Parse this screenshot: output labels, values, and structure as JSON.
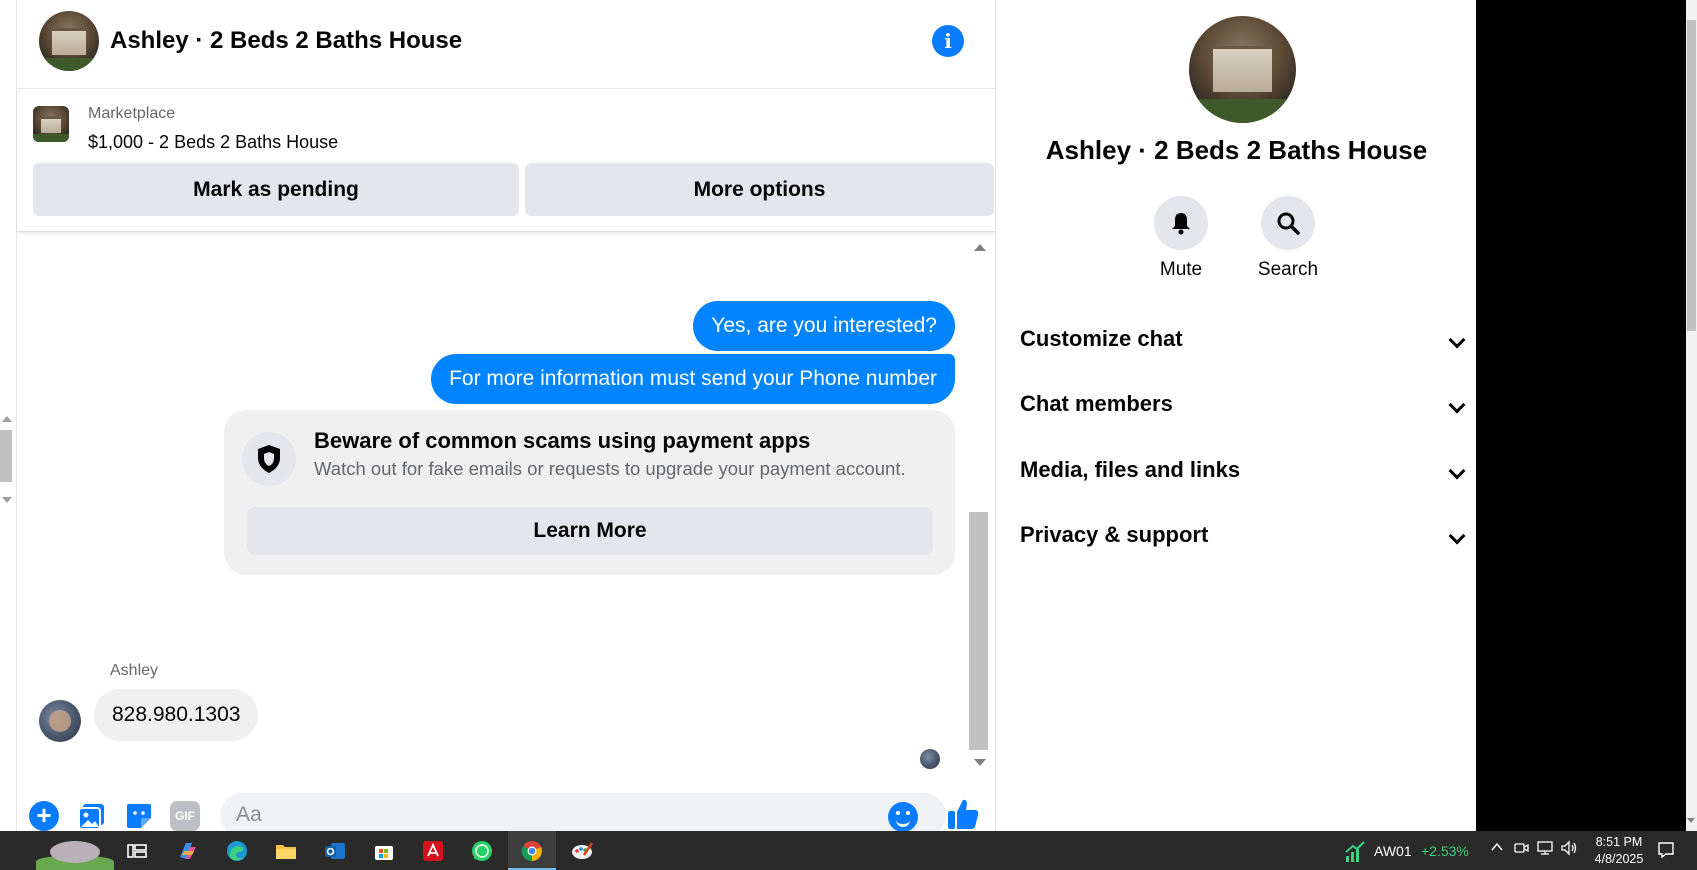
{
  "chat": {
    "title": "Ashley · 2 Beds 2 Baths House",
    "marketplace_label": "Marketplace",
    "listing": "$1,000 - 2 Beds 2 Baths House",
    "mark_pending": "Mark as pending",
    "more_options": "More options",
    "messages_out": [
      "Yes, are you interested?",
      "For more information must send your Phone number"
    ],
    "scam_notice": {
      "title": "Beware of common scams using payment apps",
      "subtitle": "Watch out for fake emails or requests to upgrade your payment account.",
      "button": "Learn More"
    },
    "sender_name": "Ashley",
    "message_in": "828.980.1303",
    "composer": {
      "placeholder": "Aa",
      "gif_label": "GIF"
    }
  },
  "info_panel": {
    "name": "Ashley · 2 Beds 2 Baths House",
    "actions": [
      {
        "label": "Mute",
        "icon": "bell-icon"
      },
      {
        "label": "Search",
        "icon": "search-icon"
      }
    ],
    "sections": [
      "Customize chat",
      "Chat members",
      "Media, files and links",
      "Privacy & support"
    ]
  },
  "taskbar": {
    "stock_symbol": "AW01",
    "stock_change": "+2.53%",
    "time": "8:51 PM",
    "date": "4/8/2025"
  },
  "colors": {
    "messenger_blue": "#0084ff",
    "accent_blue": "#0a7cff",
    "button_gray": "#e4e6eb",
    "bubble_gray": "#f0f0f0",
    "secondary_text": "#65676b"
  }
}
